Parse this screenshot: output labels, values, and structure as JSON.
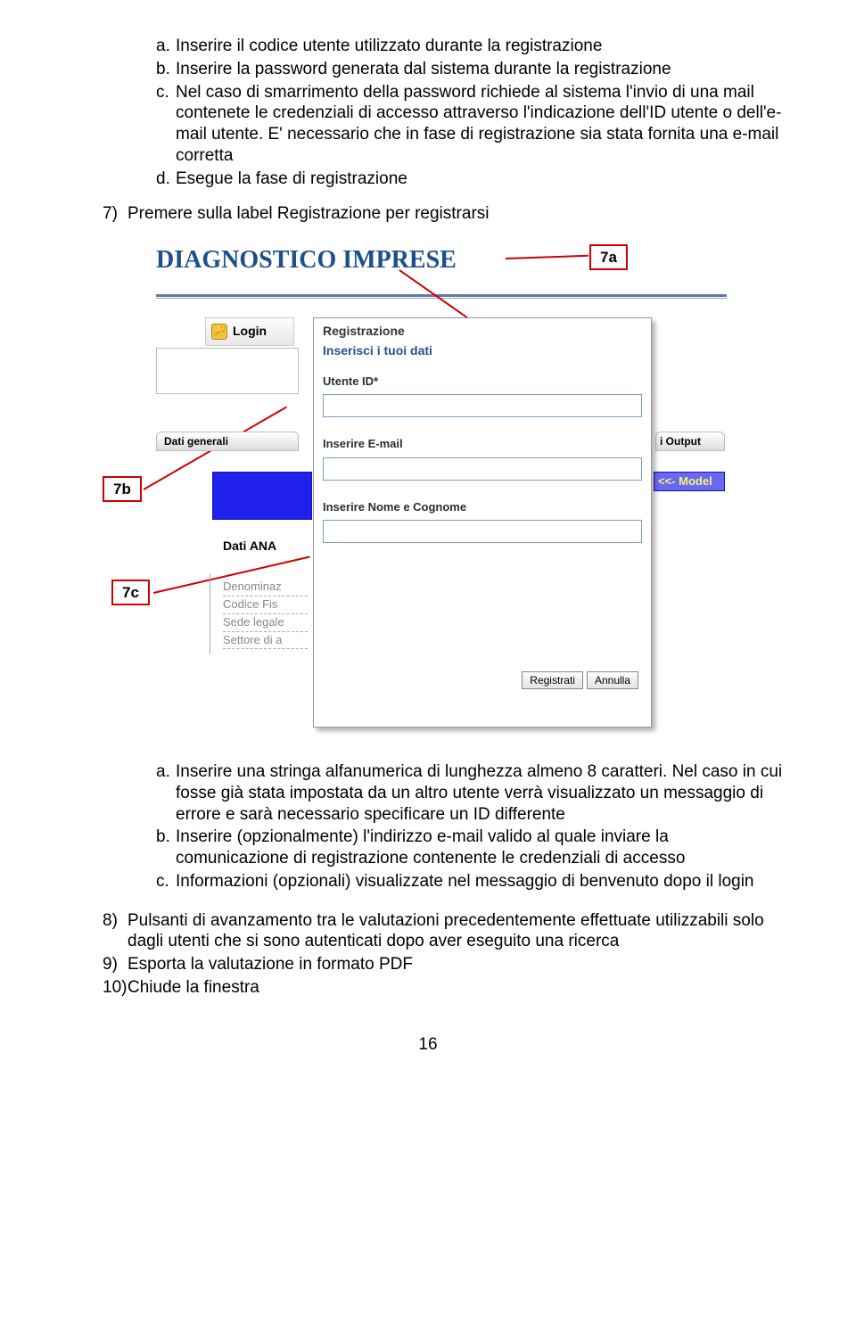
{
  "top_list": {
    "a": "Inserire il codice utente utilizzato durante la registrazione",
    "b": "Inserire la password generata dal sistema durante la registrazione",
    "c": "Nel caso di smarrimento della password richiede al sistema l'invio di una mail contenete le credenziali di accesso attraverso l'indicazione dell'ID utente o dell'e-mail utente. E' necessario che in fase di registrazione sia stata fornita una e-mail corretta",
    "d": "Esegue la fase di registrazione"
  },
  "item7": "Premere sulla label Registrazione per registrarsi",
  "screenshot": {
    "app_title": "DIAGNOSTICO IMPRESE",
    "callout_7a": "7a",
    "callout_7b": "7b",
    "callout_7c": "7c",
    "login_label": "Login",
    "tab_dati": "Dati generali",
    "tab_output": "i Output",
    "model_chip": "<<- Model",
    "dati_ana": "Dati ANA",
    "grey_rows": [
      "Denominaz",
      "Codice Fis",
      "Sede legale",
      "Settore di a"
    ],
    "dialog": {
      "hdr1": "Registrazione",
      "hdr2": "Inserisci i tuoi dati",
      "lbl_utente": "Utente ID*",
      "lbl_email": "Inserire E-mail",
      "lbl_nome": "Inserire Nome e Cognome",
      "btn_reg": "Registrati",
      "btn_ann": "Annulla"
    }
  },
  "bottom_list": {
    "a": "Inserire una stringa alfanumerica di lunghezza almeno 8 caratteri. Nel caso in cui fosse già stata impostata da un altro utente verrà visualizzato un messaggio di errore e sarà necessario specificare un ID differente",
    "b": "Inserire (opzionalmente) l'indirizzo e-mail valido al quale inviare la comunicazione di registrazione contenente le credenziali di accesso",
    "c": "Informazioni (opzionali) visualizzate nel messaggio di benvenuto dopo il login"
  },
  "item8": "Pulsanti di avanzamento tra le valutazioni precedentemente effettuate utilizzabili solo dagli utenti che si sono autenticati dopo aver eseguito una ricerca",
  "item9": "Esporta la valutazione in formato PDF",
  "item10": "Chiude la finestra",
  "page_num": "16"
}
